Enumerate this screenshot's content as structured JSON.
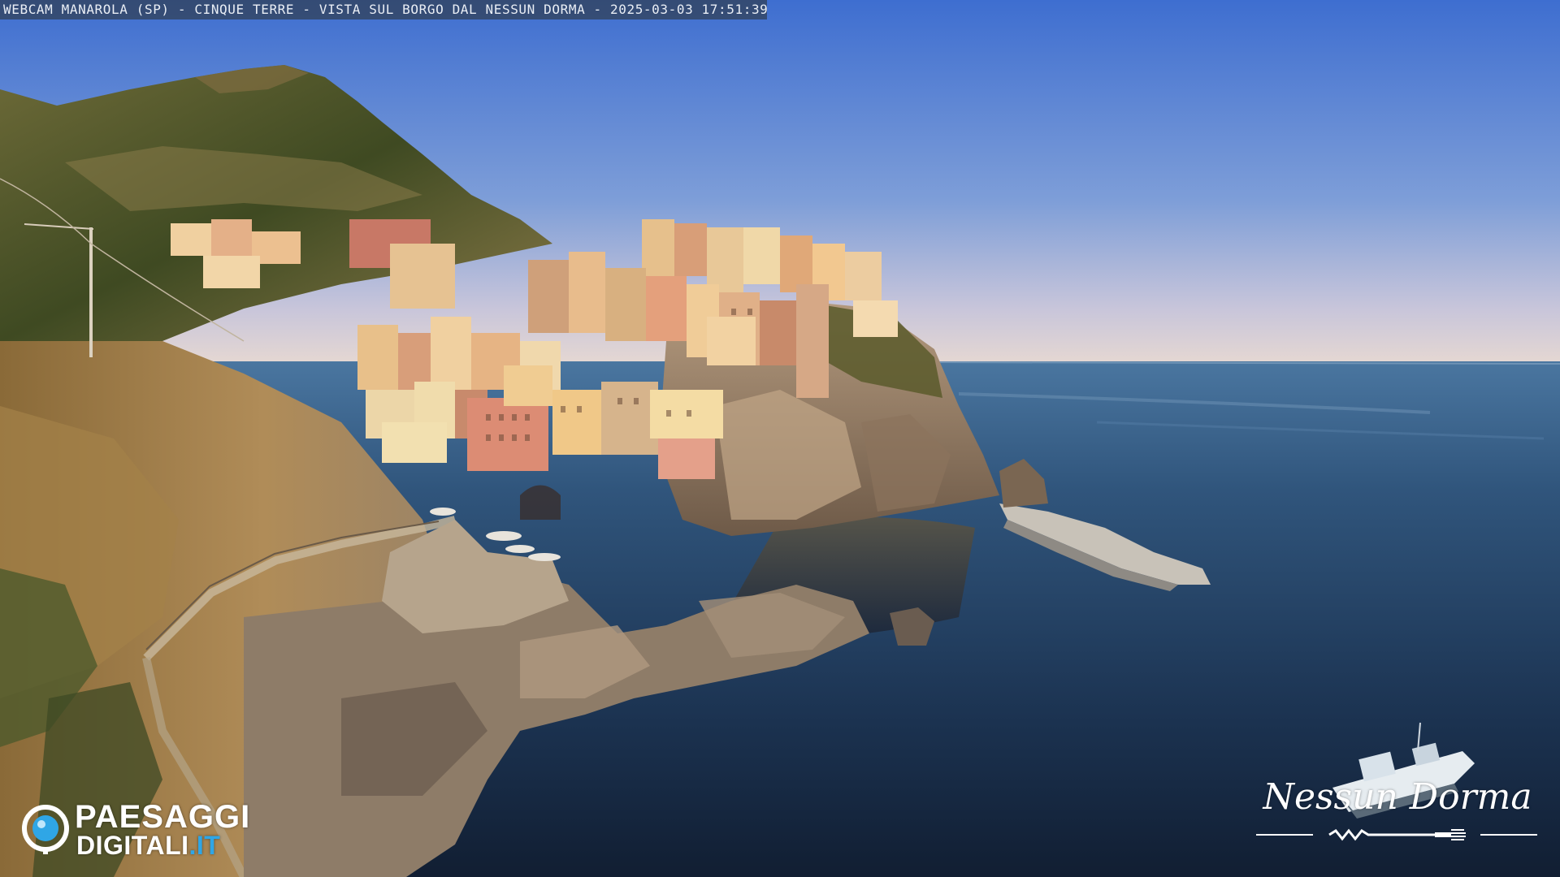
{
  "caption": {
    "text": "WEBCAM MANAROLA (SP) - CINQUE TERRE - VISTA SUL BORGO DAL NESSUN DORMA - 2025-03-03 17:51:39"
  },
  "logo_left": {
    "line1": "PAESAGGI",
    "line2": "DIGITALI",
    "tld": ".IT",
    "accent_color": "#2fa6e6",
    "icon": "camera-lens-icon"
  },
  "logo_right": {
    "text": "Nessun Dorma",
    "icon": "fork-icon"
  },
  "scene": {
    "sky_top": "#3f6fd0",
    "sky_horizon": "#e4d8d6",
    "sea_far": "#3b6488",
    "sea_near": "#14243a",
    "rock": "#a88e72",
    "vegetation": "#5a5a2a"
  }
}
